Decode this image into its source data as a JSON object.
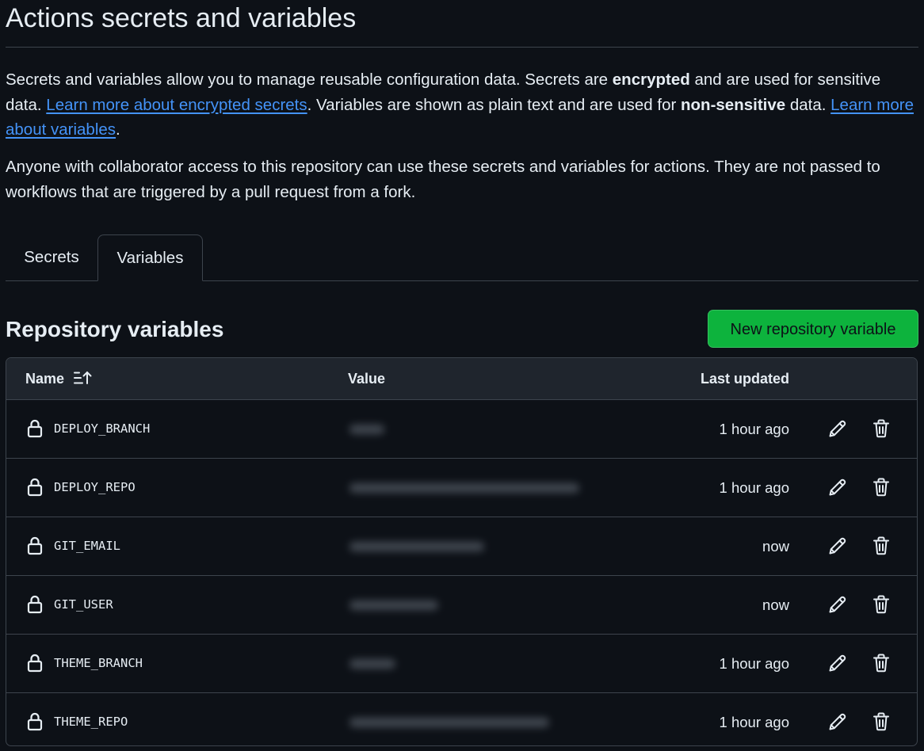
{
  "page": {
    "title": "Actions secrets and variables",
    "intro": {
      "t1": "Secrets and variables allow you to manage reusable configuration data. Secrets are ",
      "b1": "encrypted",
      "t2": " and are used for sensitive data. ",
      "link1": "Learn more about encrypted secrets",
      "t3": ". Variables are shown as plain text and are used for ",
      "b2": "non-sensitive",
      "t4": " data. ",
      "link2": "Learn more about variables",
      "t5": "."
    },
    "note": "Anyone with collaborator access to this repository can use these secrets and variables for actions. They are not passed to workflows that are triggered by a pull request from a fork."
  },
  "tabs": [
    {
      "label": "Secrets",
      "selected": false
    },
    {
      "label": "Variables",
      "selected": true
    }
  ],
  "section": {
    "title": "Repository variables",
    "new_button": "New repository variable"
  },
  "table": {
    "columns": {
      "name": "Name",
      "value": "Value",
      "last_updated": "Last updated"
    },
    "sort_icon": "sort-ascending-icon",
    "rows": [
      {
        "name": "DEPLOY_BRANCH",
        "value_blurred": true,
        "last_updated": "1 hour ago"
      },
      {
        "name": "DEPLOY_REPO",
        "value_blurred": true,
        "last_updated": "1 hour ago"
      },
      {
        "name": "GIT_EMAIL",
        "value_blurred": true,
        "last_updated": "now"
      },
      {
        "name": "GIT_USER",
        "value_blurred": true,
        "last_updated": "now"
      },
      {
        "name": "THEME_BRANCH",
        "value_blurred": true,
        "last_updated": "1 hour ago"
      },
      {
        "name": "THEME_REPO",
        "value_blurred": true,
        "last_updated": "1 hour ago"
      }
    ],
    "row_icons": {
      "lock": "lock-icon",
      "edit": "pencil-icon",
      "delete": "trash-icon"
    }
  },
  "colors": {
    "background": "#0d1117",
    "text": "#e6edf3",
    "link": "#4493f8",
    "border": "#3d444d",
    "header_bg": "#1f252d",
    "primary_button": "#0db33d"
  }
}
